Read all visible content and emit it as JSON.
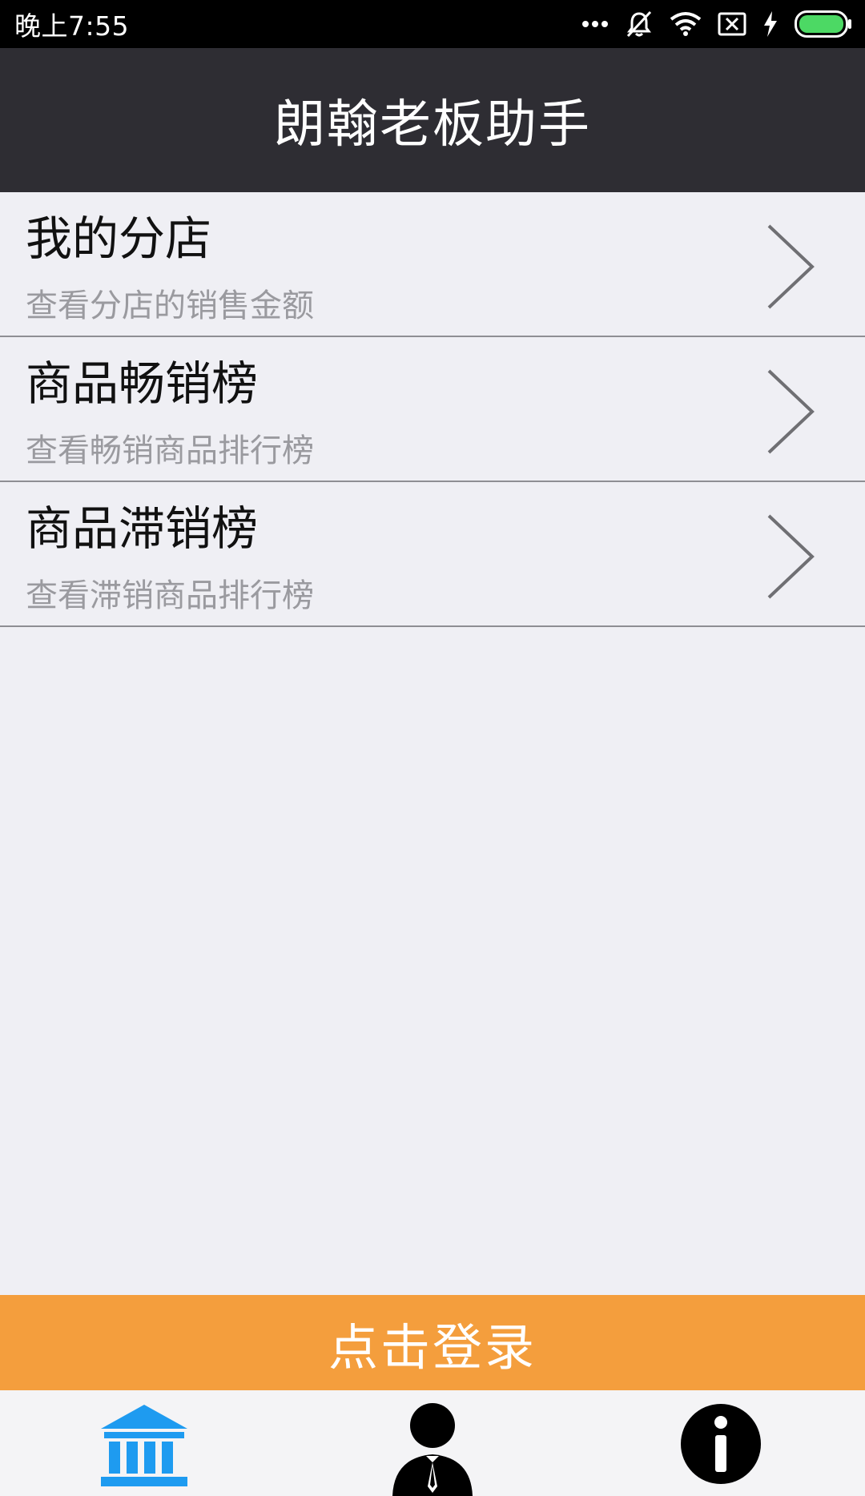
{
  "status_bar": {
    "time": "晚上7:55",
    "icons": [
      "more-dots-icon",
      "mute-icon",
      "wifi-icon",
      "sim-error-icon",
      "charging-icon",
      "battery-icon"
    ],
    "battery_color": "#4cd964"
  },
  "header": {
    "title": "朗翰老板助手"
  },
  "menu": [
    {
      "title": "我的分店",
      "subtitle": "查看分店的销售金额",
      "icon": "chevron-right-icon"
    },
    {
      "title": "商品畅销榜",
      "subtitle": "查看畅销商品排行榜",
      "icon": "chevron-right-icon"
    },
    {
      "title": "商品滞销榜",
      "subtitle": "查看滞销商品排行榜",
      "icon": "chevron-right-icon"
    }
  ],
  "login_button": {
    "label": "点击登录",
    "color": "#f49e3d"
  },
  "tab_bar": {
    "tabs": [
      {
        "icon": "bank-icon",
        "active": true,
        "color": "#1e9bf0"
      },
      {
        "icon": "user-icon",
        "active": false,
        "color": "#000000"
      },
      {
        "icon": "info-icon",
        "active": false,
        "color": "#000000"
      }
    ]
  },
  "colors": {
    "header_bg": "#2e2d33",
    "page_bg": "#efeff4",
    "accent": "#1e9bf0"
  }
}
